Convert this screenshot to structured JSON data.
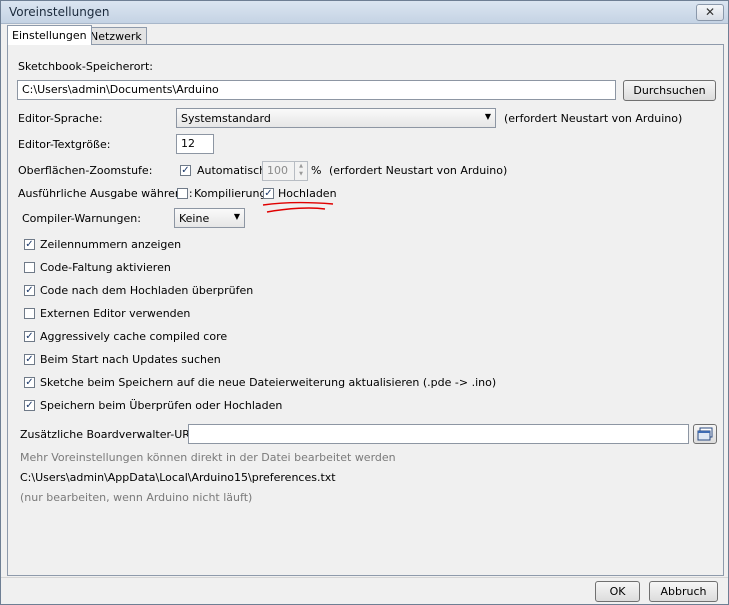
{
  "window": {
    "title": "Voreinstellungen",
    "close_glyph": "✕"
  },
  "tabs": [
    {
      "label": "Einstellungen",
      "active": true
    },
    {
      "label": "Netzwerk",
      "active": false
    }
  ],
  "sketchbook": {
    "label": "Sketchbook-Speicherort:",
    "value": "C:\\Users\\admin\\Documents\\Arduino",
    "browse_label": "Durchsuchen"
  },
  "editor_language": {
    "label": "Editor-Sprache:",
    "value": "Systemstandard",
    "note": "(erfordert Neustart von Arduino)"
  },
  "editor_font_size": {
    "label": "Editor-Textgröße:",
    "value": "12"
  },
  "zoom": {
    "label": "Oberflächen-Zoomstufe:",
    "auto_label": "Automatisch",
    "auto_checked": true,
    "value": "100",
    "unit": "%",
    "note": "(erfordert Neustart von Arduino)"
  },
  "verbose": {
    "label": "Ausführliche Ausgabe während:",
    "compile_label": "Kompilierung",
    "compile_checked": false,
    "upload_label": "Hochladen",
    "upload_checked": true
  },
  "compiler_warnings": {
    "label": "Compiler-Warnungen:",
    "value": "Keine"
  },
  "options": [
    {
      "label": "Zeilennummern anzeigen",
      "checked": true
    },
    {
      "label": "Code-Faltung aktivieren",
      "checked": false
    },
    {
      "label": "Code nach dem Hochladen überprüfen",
      "checked": true
    },
    {
      "label": "Externen Editor verwenden",
      "checked": false
    },
    {
      "label": "Aggressively cache compiled core",
      "checked": true
    },
    {
      "label": "Beim Start nach Updates suchen",
      "checked": true
    },
    {
      "label": "Sketche beim Speichern auf die neue Dateierweiterung aktualisieren (.pde -> .ino)",
      "checked": true
    },
    {
      "label": "Speichern beim Überprüfen oder Hochladen",
      "checked": true
    }
  ],
  "board_urls": {
    "label": "Zusätzliche Boardverwalter-URLs:",
    "value": ""
  },
  "footer_info": {
    "more_text": "Mehr Voreinstellungen können direkt in der Datei bearbeitet werden",
    "path": "C:\\Users\\admin\\AppData\\Local\\Arduino15\\preferences.txt",
    "hint": "(nur bearbeiten, wenn Arduino nicht läuft)"
  },
  "buttons": {
    "ok": "OK",
    "cancel": "Abbruch"
  },
  "glyphs": {
    "check": "✓",
    "dropdown": "▼",
    "spin_up": "▲",
    "spin_down": "▼"
  },
  "colors": {
    "annotation": "#e00000"
  }
}
